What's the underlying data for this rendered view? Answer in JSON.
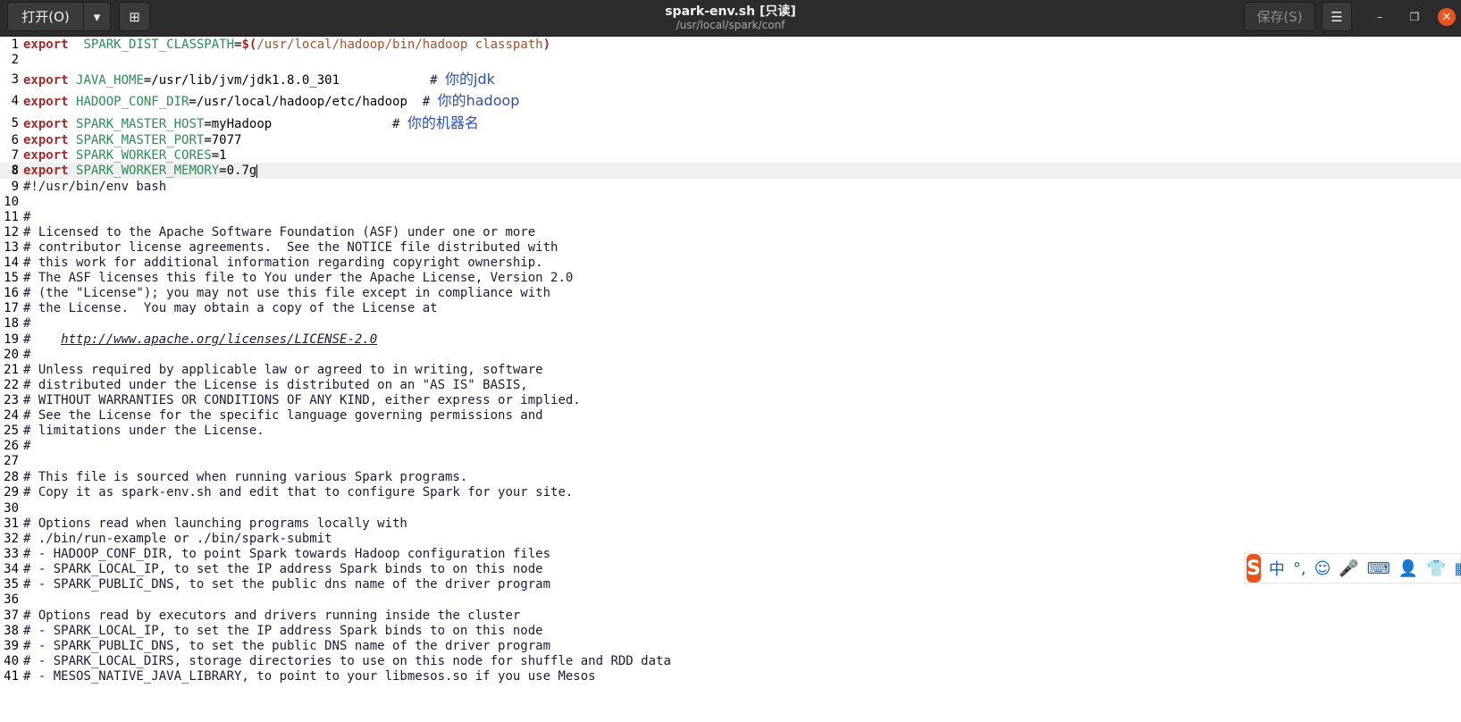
{
  "header": {
    "open_label": "打开(O)",
    "dropdown_glyph": "▾",
    "new_tab_glyph": "⊞",
    "title": "spark-env.sh [只读]",
    "subtitle": "/usr/local/spark/conf",
    "save_label": "保存(S)",
    "menu_glyph": "☰",
    "minimize_glyph": "–",
    "maximize_glyph": "❐",
    "close_glyph": "✕"
  },
  "editor": {
    "current_line": 8,
    "lines": [
      {
        "n": "1",
        "segs": [
          [
            "kw",
            "export"
          ],
          [
            "",
            "  "
          ],
          [
            "var",
            "SPARK_DIST_CLASSPATH"
          ],
          [
            "",
            "="
          ],
          [
            "subst",
            "$("
          ],
          [
            "path",
            "/usr/local/hadoop/bin/hadoop classpath"
          ],
          [
            "subst",
            ")"
          ]
        ]
      },
      {
        "n": "2",
        "segs": []
      },
      {
        "n": "3",
        "segs": [
          [
            "kw",
            "export"
          ],
          [
            "",
            " "
          ],
          [
            "var",
            "JAVA_HOME"
          ],
          [
            "",
            "=/usr/lib/jvm/jdk1.8.0_301           "
          ],
          [
            "comment",
            " # "
          ],
          [
            "cjk",
            "你的jdk"
          ]
        ]
      },
      {
        "n": "4",
        "segs": [
          [
            "kw",
            "export"
          ],
          [
            "",
            " "
          ],
          [
            "var",
            "HADOOP_CONF_DIR"
          ],
          [
            "",
            "=/usr/local/hadoop/etc/hadoop  "
          ],
          [
            "comment",
            "# "
          ],
          [
            "cjk",
            "你的hadoop"
          ]
        ]
      },
      {
        "n": "5",
        "segs": [
          [
            "kw",
            "export"
          ],
          [
            "",
            " "
          ],
          [
            "var",
            "SPARK_MASTER_HOST"
          ],
          [
            "",
            "=myHadoop                "
          ],
          [
            "comment",
            "# "
          ],
          [
            "cjk",
            "你的机器名"
          ]
        ]
      },
      {
        "n": "6",
        "segs": [
          [
            "kw",
            "export"
          ],
          [
            "",
            " "
          ],
          [
            "var",
            "SPARK_MASTER_PORT"
          ],
          [
            "",
            "=7077"
          ]
        ]
      },
      {
        "n": "7",
        "segs": [
          [
            "kw",
            "export"
          ],
          [
            "",
            " "
          ],
          [
            "var",
            "SPARK_WORKER_CORES"
          ],
          [
            "",
            "=1"
          ]
        ]
      },
      {
        "n": "8",
        "segs": [
          [
            "kw",
            "export"
          ],
          [
            "",
            " "
          ],
          [
            "var",
            "SPARK_WORKER_MEMORY"
          ],
          [
            "",
            "=0.7g"
          ]
        ]
      },
      {
        "n": "9",
        "segs": [
          [
            "comment",
            "#!/usr/bin/env bash"
          ]
        ]
      },
      {
        "n": "10",
        "segs": []
      },
      {
        "n": "11",
        "segs": [
          [
            "comment",
            "#"
          ]
        ]
      },
      {
        "n": "12",
        "segs": [
          [
            "comment",
            "# Licensed to the Apache Software Foundation (ASF) under one or more"
          ]
        ]
      },
      {
        "n": "13",
        "segs": [
          [
            "comment",
            "# contributor license agreements.  See the NOTICE file distributed with"
          ]
        ]
      },
      {
        "n": "14",
        "segs": [
          [
            "comment",
            "# this work for additional information regarding copyright ownership."
          ]
        ]
      },
      {
        "n": "15",
        "segs": [
          [
            "comment",
            "# The ASF licenses this file to You under the Apache License, Version 2.0"
          ]
        ]
      },
      {
        "n": "16",
        "segs": [
          [
            "comment",
            "# (the \"License\"); you may not use this file except in compliance with"
          ]
        ]
      },
      {
        "n": "17",
        "segs": [
          [
            "comment",
            "# the License.  You may obtain a copy of the License at"
          ]
        ]
      },
      {
        "n": "18",
        "segs": [
          [
            "comment",
            "#"
          ]
        ]
      },
      {
        "n": "19",
        "segs": [
          [
            "comment",
            "#    "
          ],
          [
            "link",
            "http://www.apache.org/licenses/LICENSE-2.0"
          ]
        ]
      },
      {
        "n": "20",
        "segs": [
          [
            "comment",
            "#"
          ]
        ]
      },
      {
        "n": "21",
        "segs": [
          [
            "comment",
            "# Unless required by applicable law or agreed to in writing, software"
          ]
        ]
      },
      {
        "n": "22",
        "segs": [
          [
            "comment",
            "# distributed under the License is distributed on an \"AS IS\" BASIS,"
          ]
        ]
      },
      {
        "n": "23",
        "segs": [
          [
            "comment",
            "# WITHOUT WARRANTIES OR CONDITIONS OF ANY KIND, either express or implied."
          ]
        ]
      },
      {
        "n": "24",
        "segs": [
          [
            "comment",
            "# See the License for the specific language governing permissions and"
          ]
        ]
      },
      {
        "n": "25",
        "segs": [
          [
            "comment",
            "# limitations under the License."
          ]
        ]
      },
      {
        "n": "26",
        "segs": [
          [
            "comment",
            "#"
          ]
        ]
      },
      {
        "n": "27",
        "segs": []
      },
      {
        "n": "28",
        "segs": [
          [
            "comment",
            "# This file is sourced when running various Spark programs."
          ]
        ]
      },
      {
        "n": "29",
        "segs": [
          [
            "comment",
            "# Copy it as spark-env.sh and edit that to configure Spark for your site."
          ]
        ]
      },
      {
        "n": "30",
        "segs": []
      },
      {
        "n": "31",
        "segs": [
          [
            "comment",
            "# Options read when launching programs locally with"
          ]
        ]
      },
      {
        "n": "32",
        "segs": [
          [
            "comment",
            "# ./bin/run-example or ./bin/spark-submit"
          ]
        ]
      },
      {
        "n": "33",
        "segs": [
          [
            "comment",
            "# - HADOOP_CONF_DIR, to point Spark towards Hadoop configuration files"
          ]
        ]
      },
      {
        "n": "34",
        "segs": [
          [
            "comment",
            "# - SPARK_LOCAL_IP, to set the IP address Spark binds to on this node"
          ]
        ]
      },
      {
        "n": "35",
        "segs": [
          [
            "comment",
            "# - SPARK_PUBLIC_DNS, to set the public dns name of the driver program"
          ]
        ]
      },
      {
        "n": "36",
        "segs": []
      },
      {
        "n": "37",
        "segs": [
          [
            "comment",
            "# Options read by executors and drivers running inside the cluster"
          ]
        ]
      },
      {
        "n": "38",
        "segs": [
          [
            "comment",
            "# - SPARK_LOCAL_IP, to set the IP address Spark binds to on this node"
          ]
        ]
      },
      {
        "n": "39",
        "segs": [
          [
            "comment",
            "# - SPARK_PUBLIC_DNS, to set the public DNS name of the driver program"
          ]
        ]
      },
      {
        "n": "40",
        "segs": [
          [
            "comment",
            "# - SPARK_LOCAL_DIRS, storage directories to use on this node for shuffle and RDD data"
          ]
        ]
      },
      {
        "n": "41",
        "segs": [
          [
            "comment",
            "# - MESOS_NATIVE_JAVA_LIBRARY, to point to your libmesos.so if you use Mesos"
          ]
        ]
      }
    ]
  },
  "ime": {
    "logo": "S",
    "items": [
      {
        "name": "ime-chinese-mode",
        "glyph": "中"
      },
      {
        "name": "ime-punctuation-icon",
        "glyph": "°,"
      },
      {
        "name": "ime-emoji-icon",
        "glyph": "☺"
      },
      {
        "name": "ime-voice-icon",
        "glyph": "🎤"
      },
      {
        "name": "ime-keyboard-icon",
        "glyph": "⌨"
      },
      {
        "name": "ime-user-icon",
        "glyph": "👤"
      },
      {
        "name": "ime-skin-icon",
        "glyph": "👕"
      },
      {
        "name": "ime-toolbox-icon",
        "glyph": "▦"
      }
    ]
  }
}
